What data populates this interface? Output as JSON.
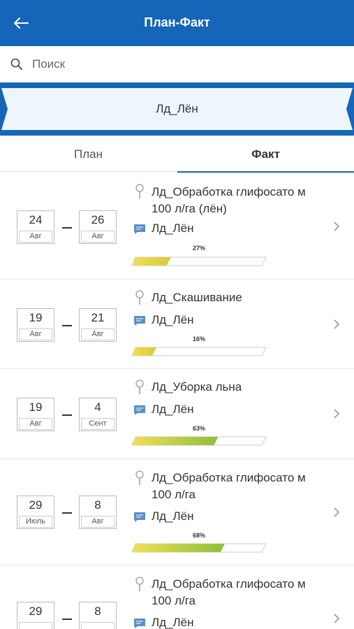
{
  "header": {
    "title": "План-Факт"
  },
  "search": {
    "placeholder": "Поиск"
  },
  "filter": {
    "label": "Лд_Лён"
  },
  "tabs": {
    "plan": "План",
    "fact": "Факт"
  },
  "colors": {
    "primary": "#1565b8",
    "progress_start": "#f1df56",
    "progress_end": "#8fbf3c"
  },
  "rows": [
    {
      "start_day": "24",
      "start_month": "Авг",
      "end_day": "26",
      "end_month": "Авг",
      "operation": "Лд_Обработка глифосато м 100 л/га (лён)",
      "field": "Лд_Лён",
      "progress_label": "27%",
      "progress": 0.27
    },
    {
      "start_day": "19",
      "start_month": "Авг",
      "end_day": "21",
      "end_month": "Авг",
      "operation": "Лд_Скашивание",
      "field": "Лд_Лён",
      "progress_label": "16%",
      "progress": 0.16
    },
    {
      "start_day": "19",
      "start_month": "Авг",
      "end_day": "4",
      "end_month": "Сент",
      "operation": "Лд_Уборка льна",
      "field": "Лд_Лён",
      "progress_label": "63%",
      "progress": 0.63
    },
    {
      "start_day": "29",
      "start_month": "Июль",
      "end_day": "8",
      "end_month": "Авг",
      "operation": "Лд_Обработка глифосато м 100 л/га",
      "field": "Лд_Лён",
      "progress_label": "68%",
      "progress": 0.68
    },
    {
      "start_day": "29",
      "start_month": "",
      "end_day": "8",
      "end_month": "",
      "operation": "Лд_Обработка глифосато м 100 л/га",
      "field": "Лд_Лён",
      "progress_label": "",
      "progress": null
    }
  ]
}
